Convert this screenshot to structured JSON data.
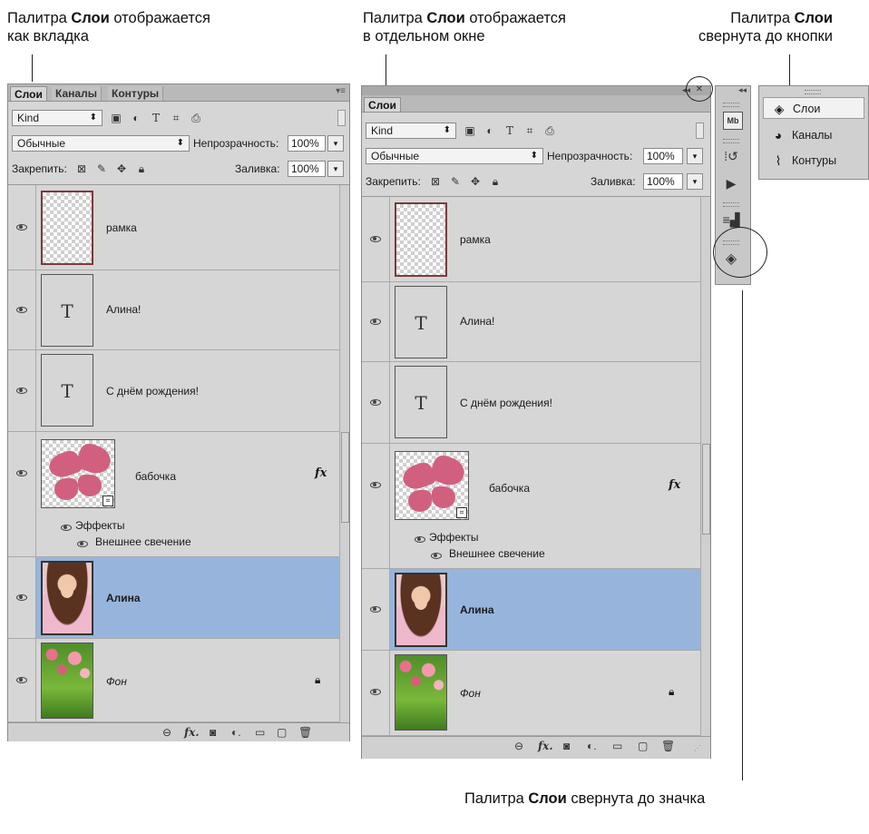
{
  "captions": {
    "tab_line1_a": "Палитра ",
    "tab_line1_b": "Слои",
    "tab_line1_c": " отображается",
    "tab_line2": "как вкладка",
    "win_line1_a": "Палитра ",
    "win_line1_b": "Слои",
    "win_line1_c": " отображается",
    "win_line2": "в отдельном окне",
    "btn_line1_a": "Палитра ",
    "btn_line1_b": "Слои",
    "btn_line2": "свернута до кнопки",
    "icon_a": "Палитра ",
    "icon_b": "Слои",
    "icon_c": " свернута до значка"
  },
  "tabs": {
    "layers": "Слои",
    "channels": "Каналы",
    "paths": "Контуры"
  },
  "filter": {
    "kind": "Kind",
    "icons": [
      "image-icon",
      "adjustment-icon",
      "type-icon",
      "shape-icon",
      "smart-object-icon"
    ]
  },
  "blend": {
    "mode": "Обычные",
    "opacity_label": "Непрозрачность:",
    "opacity_value": "100%"
  },
  "lock": {
    "label": "Закрепить:",
    "fill_label": "Заливка:",
    "fill_value": "100%"
  },
  "layers": [
    {
      "name": "рамка",
      "kind": "frame"
    },
    {
      "name": "Алина!",
      "kind": "text",
      "glyph": "T"
    },
    {
      "name": "С днём рождения!",
      "kind": "text",
      "glyph": "T"
    },
    {
      "name": "бабочка",
      "kind": "butterfly",
      "fx": "fx",
      "effects_label": "Эффекты",
      "effect": "Внешнее свечение"
    },
    {
      "name": "Алина",
      "kind": "photo",
      "selected": true
    },
    {
      "name": "Фон",
      "kind": "background",
      "locked": true
    }
  ],
  "button_panel": {
    "items": [
      "Слои",
      "Каналы",
      "Контуры"
    ]
  },
  "dock": {
    "icons": [
      "mini-bridge-icon",
      "history-icon",
      "actions-icon",
      "tool-presets-icon",
      "layers-icon"
    ]
  },
  "colors": {
    "selected": "#97b5dc",
    "panel": "#d6d6d6",
    "butterfly": "#d1607f"
  }
}
